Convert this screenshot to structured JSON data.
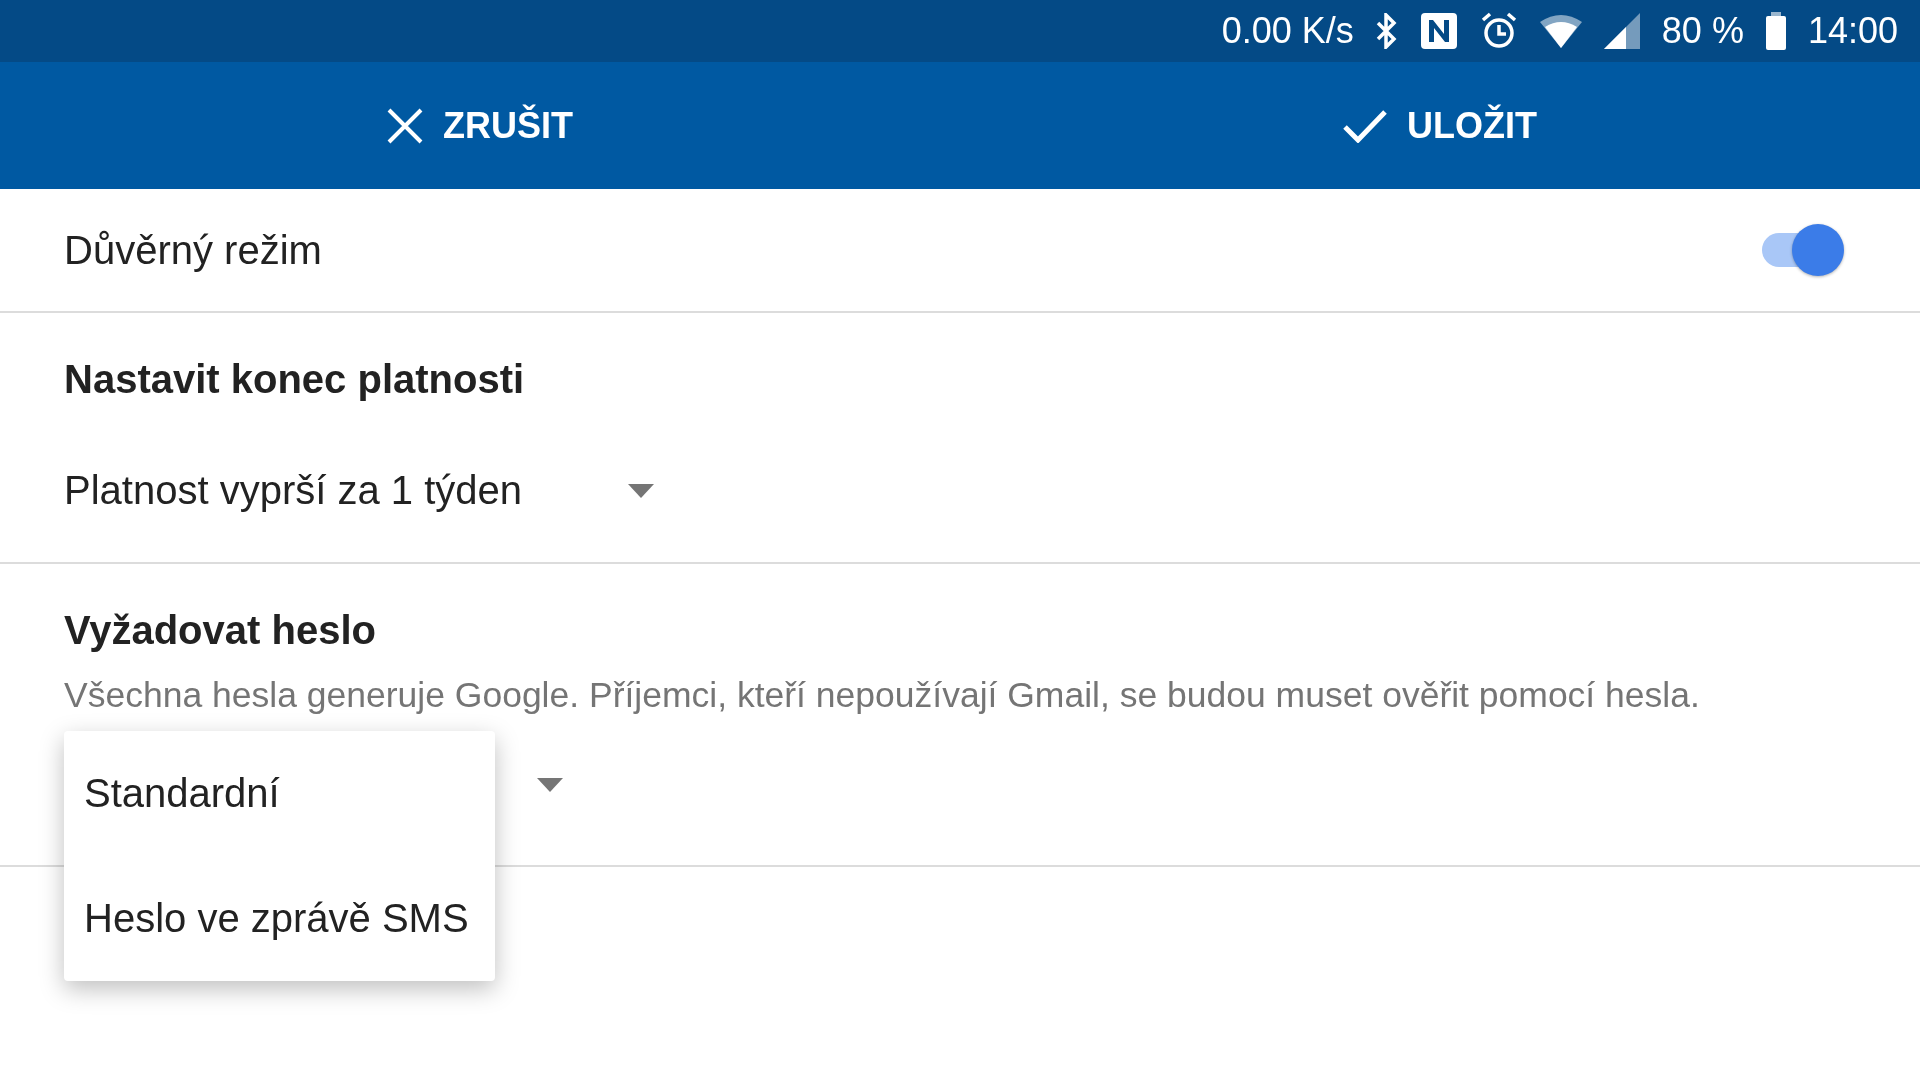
{
  "status_bar": {
    "speed": "0.00 K/s",
    "battery": "80 %",
    "time": "14:00"
  },
  "action_bar": {
    "cancel": "ZRUŠIT",
    "save": "ULOŽIT"
  },
  "confidential_mode": {
    "label": "Důvěrný režim",
    "on": true
  },
  "expiry": {
    "title": "Nastavit konec platnosti",
    "value": "Platnost vyprší za 1 týden"
  },
  "password": {
    "title": "Vyžadovat heslo",
    "description": "Všechna hesla generuje Google. Příjemci, kteří nepoužívají Gmail, se budou muset ověřit pomocí hesla.",
    "menu_open": true,
    "options": [
      {
        "label": "Standardní"
      },
      {
        "label": "Heslo ve zprávě SMS"
      }
    ]
  }
}
